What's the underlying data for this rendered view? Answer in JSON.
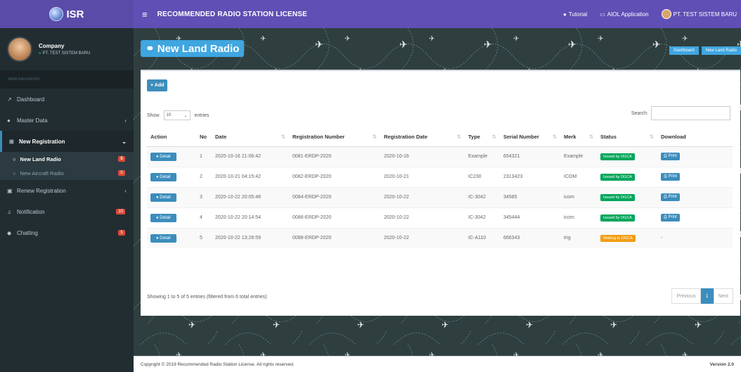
{
  "app": {
    "logo_text": "ISR"
  },
  "topbar": {
    "title": "RECOMMENDED RADIO STATION LICENSE",
    "tutorial": "Tutorial",
    "aiol": "AIOL Application",
    "user": "PT. TEST SISTEM BARU"
  },
  "sidebar": {
    "user_name": "Company",
    "user_status": "PT. TEST SISTEM BARU",
    "header": "MAIN NAVIGATION",
    "items": [
      {
        "label": "Dashboard",
        "icon": "chart-line-icon"
      },
      {
        "label": "Master Data",
        "icon": "database-icon"
      },
      {
        "label": "New Registration",
        "icon": "sitemap-icon"
      },
      {
        "label": "Renew Registration",
        "icon": "edit-icon"
      },
      {
        "label": "Notification",
        "icon": "bell-icon",
        "badge": "10"
      },
      {
        "label": "Chatting",
        "icon": "comments-icon",
        "badge": "5"
      }
    ],
    "sub_items": [
      {
        "label": "New Land Radio",
        "badge": "5"
      },
      {
        "label": "New Aircraft Radio",
        "badge": "0"
      }
    ]
  },
  "page": {
    "heading": "New Land Radio",
    "breadcrumb": [
      "Dashboard",
      "New Land Radio"
    ],
    "add_label": "+ Add",
    "show_label": "Show",
    "entries_value": "10",
    "entries_label": "entries",
    "search_label": "Search:",
    "columns": [
      "Action",
      "No",
      "Date",
      "Registration Number",
      "Registration Date",
      "Type",
      "Serial Number",
      "Merk",
      "Status",
      "Download"
    ],
    "rows": [
      {
        "action": "Detail",
        "no": "1",
        "date": "2020-10-16 21:06:42",
        "reg_no": "0081-ERDP-2020",
        "reg_date": "2020-10-16",
        "type": "Example",
        "serial": "654321",
        "merk": "Example",
        "status": "Issued by DGCA",
        "status_color": "#00a65a",
        "download": "Print"
      },
      {
        "action": "Detail",
        "no": "2",
        "date": "2020-10-21 04:15:42",
        "reg_no": "0082-ERDP-2020",
        "reg_date": "2020-10-21",
        "type": "IC230",
        "serial": "2313423",
        "merk": "ICOM",
        "status": "Issued by DGCA",
        "status_color": "#00a65a",
        "download": "Print"
      },
      {
        "action": "Detail",
        "no": "3",
        "date": "2020-10-22 20:05:48",
        "reg_no": "0084-ERDP-2020",
        "reg_date": "2020-10-22",
        "type": "IC-3042",
        "serial": "34585",
        "merk": "icom",
        "status": "Issued by DGCA",
        "status_color": "#00a65a",
        "download": "Print"
      },
      {
        "action": "Detail",
        "no": "4",
        "date": "2020-10-22 20:14:54",
        "reg_no": "0086-ERDP-2020",
        "reg_date": "2020-10-22",
        "type": "IC-3042",
        "serial": "345444",
        "merk": "icom",
        "status": "Issued by DGCA",
        "status_color": "#00a65a",
        "download": "Print"
      },
      {
        "action": "Detail",
        "no": "5",
        "date": "2020-10-22 13:28:59",
        "reg_no": "0088-ERDP-2020",
        "reg_date": "2020-10-22",
        "type": "IC-A110",
        "serial": "666343",
        "merk": "trig",
        "status": "Waiting to DGCA",
        "status_color": "#f39c12",
        "download": "-"
      }
    ],
    "info": "Showing 1 to 5 of 5 entries (filtered from 6 total entries)",
    "pager": {
      "prev": "Previous",
      "current": "1",
      "next": "Next"
    }
  },
  "footer": {
    "copyright": "Copyright © 2019 Recommended Radio Station License. All rights reserved.",
    "version": "Version 2.0"
  }
}
